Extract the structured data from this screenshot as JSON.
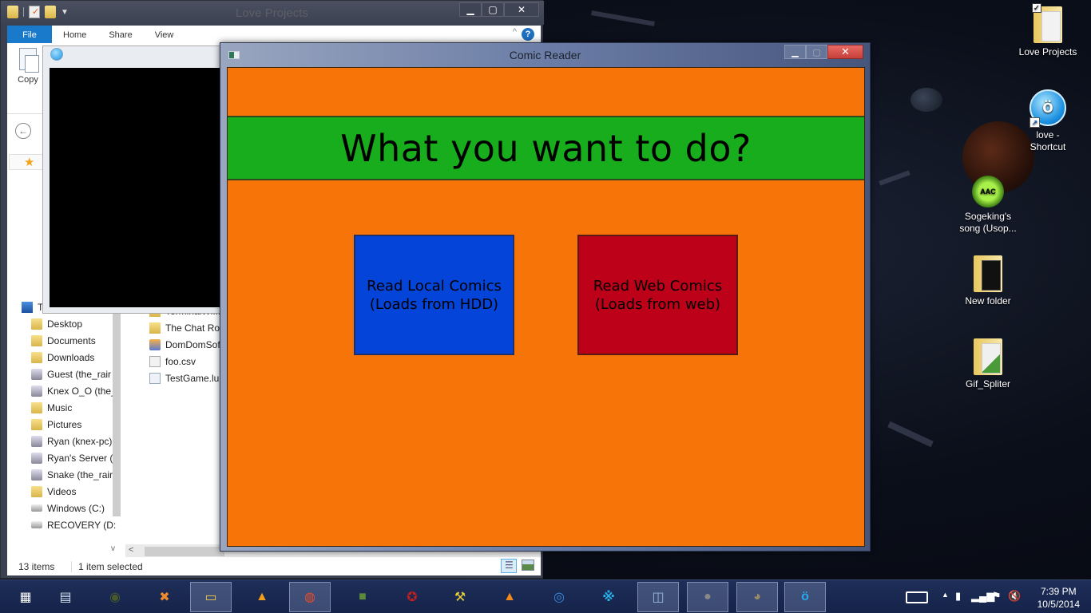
{
  "explorer": {
    "title": "Love Projects",
    "ribbon_tabs": [
      "File",
      "Home",
      "Share",
      "View"
    ],
    "copy_label": "Copy",
    "window_controls": {
      "minimize": "▁",
      "maximize": "▢",
      "close": "✕"
    },
    "help_label": "?",
    "nav_items": [
      {
        "label": "This PC",
        "icon": "pc-icon"
      },
      {
        "label": "Desktop",
        "icon": "folder-icon"
      },
      {
        "label": "Documents",
        "icon": "folder-icon"
      },
      {
        "label": "Downloads",
        "icon": "folder-icon"
      },
      {
        "label": "Guest (the_rair",
        "icon": "network-share-icon"
      },
      {
        "label": "Knex O_O (the_",
        "icon": "network-share-icon"
      },
      {
        "label": "Music",
        "icon": "folder-icon"
      },
      {
        "label": "Pictures",
        "icon": "folder-icon"
      },
      {
        "label": "Ryan (knex-pc)",
        "icon": "network-share-icon"
      },
      {
        "label": "Ryan's Server (",
        "icon": "network-share-icon"
      },
      {
        "label": "Snake (the_rair",
        "icon": "network-share-icon"
      },
      {
        "label": "Videos",
        "icon": "folder-icon"
      },
      {
        "label": "Windows (C:)",
        "icon": "drive-icon"
      },
      {
        "label": "RECOVERY (D:",
        "icon": "drive-icon"
      }
    ],
    "files": [
      {
        "name": "TerminalWi...",
        "type": "folder"
      },
      {
        "name": "The Chat Ro",
        "type": "folder"
      },
      {
        "name": "DomDomSof",
        "type": "app"
      },
      {
        "name": "foo.csv",
        "type": "doc"
      },
      {
        "name": "TestGame.lu",
        "type": "lua"
      }
    ],
    "status": {
      "count": "13 items",
      "selected": "1 item selected"
    }
  },
  "comic_reader": {
    "title": "Comic Reader",
    "window_controls": {
      "minimize": "▁",
      "maximize": "▢",
      "close": "✕"
    },
    "prompt": "What you want to do?",
    "buttons": {
      "local": {
        "line1": "Read Local Comics",
        "line2": "(Loads from HDD)",
        "color": "#0444d9"
      },
      "web": {
        "line1": "Read Web Comics",
        "line2": "(Loads from web)",
        "color": "#bc0119"
      }
    },
    "colors": {
      "background": "#f77408",
      "banner": "#17ad1c"
    }
  },
  "desktop_icons": [
    {
      "label": "Love Projects",
      "icon": "folder-icon"
    },
    {
      "label": "love - Shortcut",
      "icon": "love-icon"
    },
    {
      "label": "Sogeking's song (Usop...",
      "icon": "aac-audio-icon"
    },
    {
      "label": "New folder",
      "icon": "folder-icon"
    },
    {
      "label": "Gif_Spliter",
      "icon": "folder-icon"
    }
  ],
  "taskbar": {
    "apps": [
      {
        "name": "start-icon",
        "glyph": "▦",
        "color": "#ffffff"
      },
      {
        "name": "window-switcher-icon",
        "glyph": "▤",
        "color": "#cfe3f0"
      },
      {
        "name": "dragon-eye-icon",
        "glyph": "◉",
        "color": "#4a5a2a"
      },
      {
        "name": "xsplit-icon",
        "glyph": "✖",
        "color": "#f08a2a"
      },
      {
        "name": "file-explorer-icon",
        "glyph": "▭",
        "color": "#f2c94a"
      },
      {
        "name": "aimp-icon",
        "glyph": "▲",
        "color": "#f2a01a"
      },
      {
        "name": "firefox-nightly-icon",
        "glyph": "◍",
        "color": "#e84a2a"
      },
      {
        "name": "minecraft-icon",
        "glyph": "■",
        "color": "#5a8a3a"
      },
      {
        "name": "skyrim-icon",
        "glyph": "✪",
        "color": "#c02020"
      },
      {
        "name": "shovel-icon",
        "glyph": "⚒",
        "color": "#e8d03a"
      },
      {
        "name": "vlc-icon",
        "glyph": "▲",
        "color": "#f28a1a"
      },
      {
        "name": "chrome-icon",
        "glyph": "◎",
        "color": "#3a8ae0"
      },
      {
        "name": "razer-icon",
        "glyph": "※",
        "color": "#2ab0e8"
      },
      {
        "name": "resource-monitor-icon",
        "glyph": "◫",
        "color": "#9ab8d8"
      },
      {
        "name": "sphere-app-icon",
        "glyph": "●",
        "color": "#888888"
      },
      {
        "name": "gimp-icon",
        "glyph": "◕",
        "color": "#9a8a6a"
      },
      {
        "name": "love-app-icon",
        "glyph": "ö",
        "color": "#2aa8f0"
      }
    ],
    "clock": {
      "time": "7:39 PM",
      "date": "10/5/2014"
    }
  }
}
